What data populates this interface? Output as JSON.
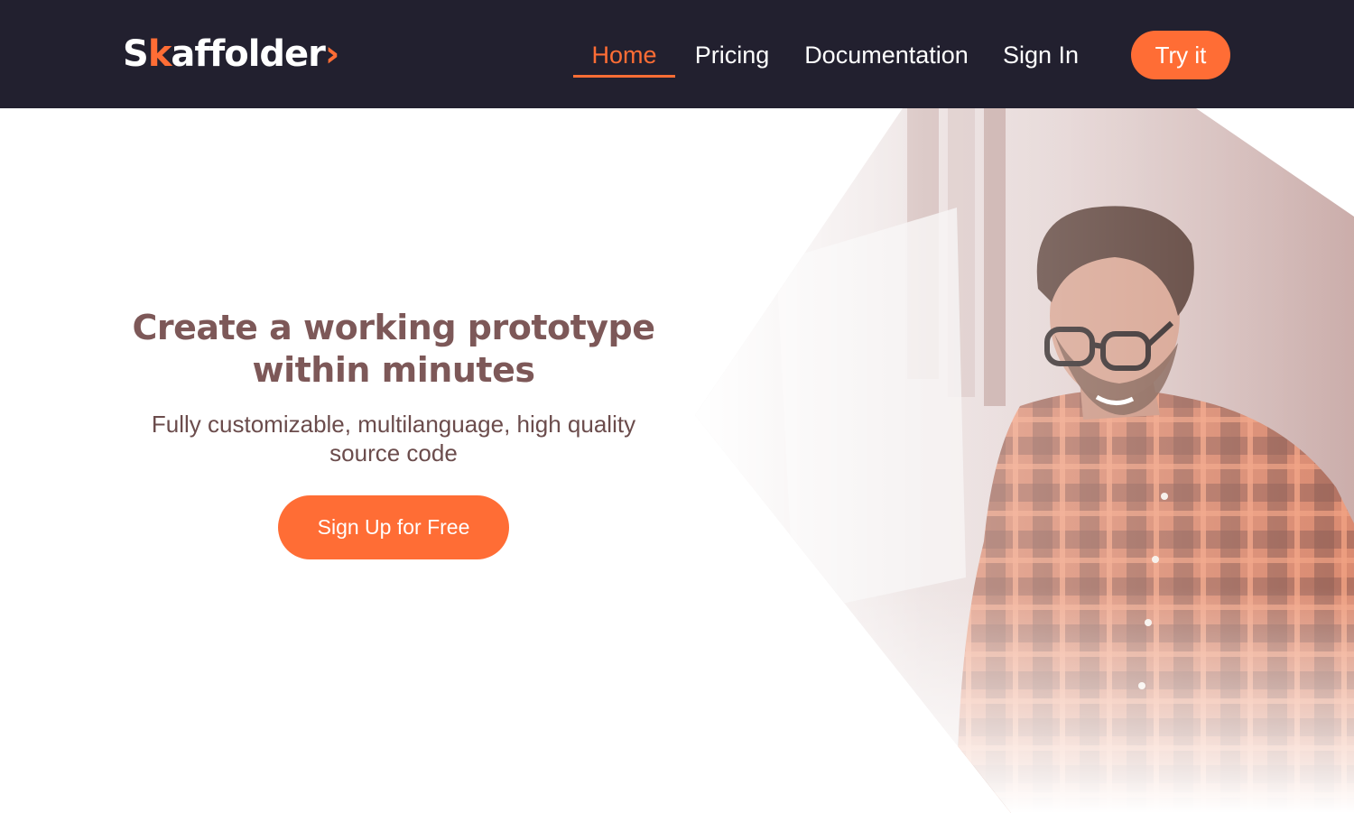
{
  "header": {
    "logo": {
      "prefix": "S",
      "accent_letter": "k",
      "suffix": "affolder",
      "chevron": "›"
    },
    "nav": [
      {
        "label": "Home",
        "active": true
      },
      {
        "label": "Pricing",
        "active": false
      },
      {
        "label": "Documentation",
        "active": false
      },
      {
        "label": "Sign In",
        "active": false
      }
    ],
    "cta_label": "Try it"
  },
  "hero": {
    "title_line1": "Create a working prototype",
    "title_line2": "within minutes",
    "subtitle_line1": "Fully customizable, multilanguage, high quality",
    "subtitle_line2": "source code",
    "signup_label": "Sign Up for Free",
    "image": "developer-in-plaid-shirt-photo"
  },
  "colors": {
    "nav_background": "#22202f",
    "accent": "#ff6d35",
    "headline": "#7d5858",
    "body_text": "#6b4c4c",
    "background": "#ffffff"
  }
}
